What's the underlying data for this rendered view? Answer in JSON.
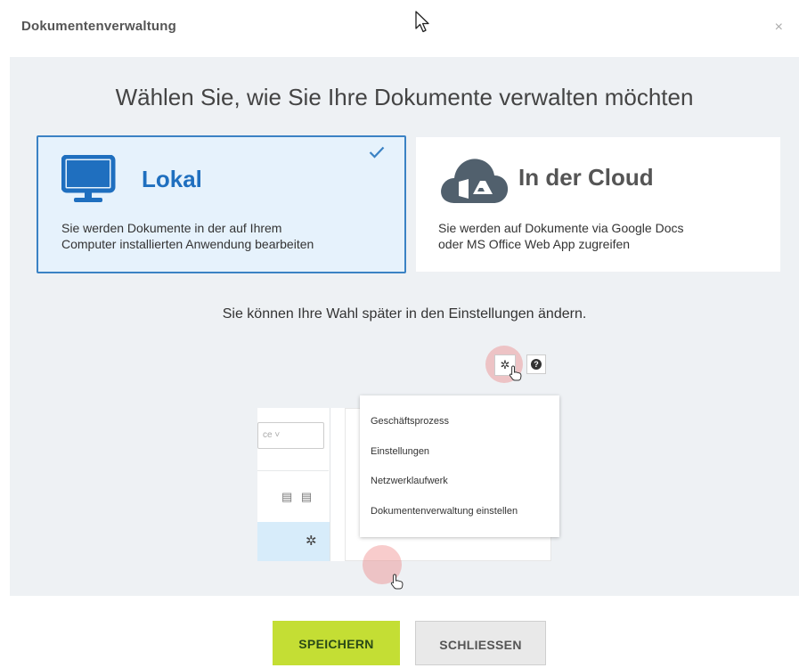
{
  "header": {
    "title": "Dokumentenverwaltung",
    "close_icon": "close-icon",
    "close_glyph": "×"
  },
  "main": {
    "heading": "Wählen Sie, wie Sie Ihre Dokumente verwalten möchten",
    "options": [
      {
        "title": "Lokal",
        "description_line1": "Sie werden Dokumente in der auf Ihrem",
        "description_line2": "Computer installierten Anwendung bearbeiten",
        "icon": "monitor-icon",
        "selected": true
      },
      {
        "title": "In der Cloud",
        "description_line1": "Sie werden auf Dokumente via Google Docs",
        "description_line2": "oder MS Office Web App zugreifen",
        "icon": "cloud-icon",
        "selected": false
      }
    ],
    "hint": "Sie können Ihre Wahl später in den Einstellungen ändern.",
    "illustration": {
      "select_text": "ce ˅",
      "menu_items": [
        "Geschäftsprozess",
        "Einstellungen",
        "Netzwerklaufwerk",
        "Dokumentenverwaltung einstellen"
      ]
    }
  },
  "footer": {
    "save_label": "SPEICHERN",
    "close_label": "SCHLIESSEN"
  },
  "colors": {
    "accent": "#3b82c4",
    "title_blue": "#1f6fbf",
    "save_green": "#c4de34",
    "background_panel": "#eef1f4",
    "selected_bg": "#e6f2fc"
  }
}
